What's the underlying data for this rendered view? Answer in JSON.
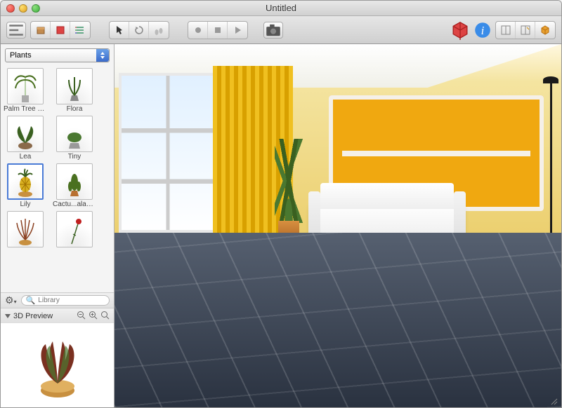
{
  "window": {
    "title": "Untitled"
  },
  "sidebar": {
    "category": "Plants",
    "items": [
      {
        "label": "Palm Tree High"
      },
      {
        "label": "Flora"
      },
      {
        "label": "Lea"
      },
      {
        "label": "Tiny"
      },
      {
        "label": "Lily",
        "selected": true
      },
      {
        "label": "Cactu...alahari"
      },
      {
        "label": ""
      },
      {
        "label": ""
      }
    ],
    "search": {
      "placeholder": "Library"
    },
    "preview_label": "3D Preview"
  }
}
